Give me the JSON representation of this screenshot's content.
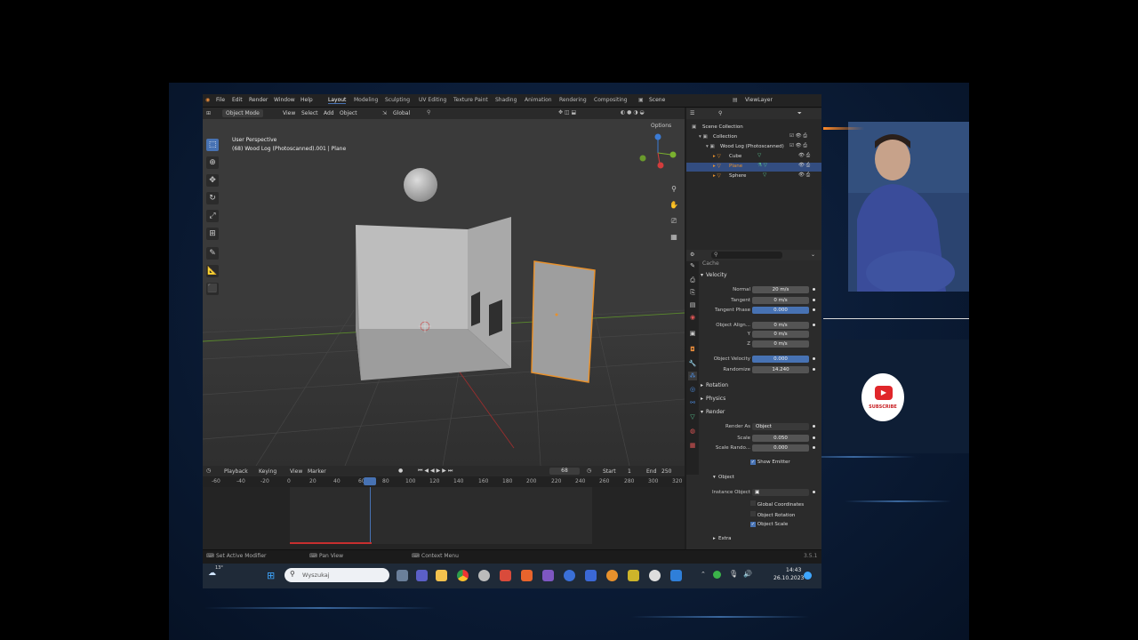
{
  "topbar": {
    "menus": [
      "File",
      "Edit",
      "Render",
      "Window",
      "Help"
    ],
    "workspaces": [
      "Layout",
      "Modeling",
      "Sculpting",
      "UV Editing",
      "Texture Paint",
      "Shading",
      "Animation",
      "Rendering",
      "Compositing"
    ],
    "active_workspace": "Layout",
    "scene": "Scene",
    "viewlayer": "ViewLayer"
  },
  "viewport": {
    "mode": "Object Mode",
    "menus": [
      "View",
      "Select",
      "Add",
      "Object"
    ],
    "orientation": "Global",
    "options": "Options",
    "overlay_title": "User Perspective",
    "overlay_sub": "(68) Wood Log (Photoscanned).001 | Plane"
  },
  "outliner": {
    "title": "Scene Collection",
    "items": [
      {
        "label": "Collection",
        "indent": 1
      },
      {
        "label": "Wood Log (Photoscanned)",
        "indent": 2
      },
      {
        "label": "Cube",
        "indent": 3
      },
      {
        "label": "Plane",
        "indent": 3,
        "selected": true
      },
      {
        "label": "Sphere",
        "indent": 3
      }
    ]
  },
  "properties": {
    "sections": {
      "cache": "Cache",
      "velocity": "Velocity",
      "rotation": "Rotation",
      "physics": "Physics",
      "render": "Render",
      "object": "Object",
      "extra": "Extra"
    },
    "rows": {
      "normal": {
        "label": "Normal",
        "value": "20 m/s"
      },
      "tangent": {
        "label": "Tangent",
        "value": "0 m/s"
      },
      "tangent_phase": {
        "label": "Tangent Phase",
        "value": "0.000"
      },
      "obj_align_x": {
        "label": "Object Align...",
        "value": "0 m/s"
      },
      "obj_align_y": {
        "label": "Y",
        "value": "0 m/s"
      },
      "obj_align_z": {
        "label": "Z",
        "value": "0 m/s"
      },
      "object_velocity": {
        "label": "Object Velocity",
        "value": "0.000"
      },
      "randomize": {
        "label": "Randomize",
        "value": "14.240"
      },
      "render_as": {
        "label": "Render As",
        "value": "Object"
      },
      "scale": {
        "label": "Scale",
        "value": "0.050"
      },
      "scale_random": {
        "label": "Scale Rando...",
        "value": "0.000"
      },
      "instance_object": {
        "label": "Instance Object",
        "value": ""
      }
    },
    "checks": {
      "show_emitter": "Show Emitter",
      "global_coords": "Global Coordinates",
      "object_rotation": "Object Rotation",
      "object_scale": "Object Scale"
    }
  },
  "timeline": {
    "menus": [
      "Playback",
      "Keying",
      "View",
      "Marker"
    ],
    "current_frame": "68",
    "start_label": "Start",
    "start": "1",
    "end_label": "End",
    "end": "250",
    "ticks": [
      "-60",
      "-40",
      "-20",
      "0",
      "20",
      "40",
      "60",
      "80",
      "100",
      "120",
      "140",
      "160",
      "180",
      "200",
      "220",
      "240",
      "260",
      "280",
      "300",
      "320"
    ]
  },
  "statusbar": {
    "left": "Set Active Modifier",
    "mid": "Pan View",
    "right": "Context Menu",
    "version": "3.5.1"
  },
  "taskbar": {
    "weather": "13°",
    "search_placeholder": "Wyszukaj",
    "time": "14:43",
    "date": "26.10.2023"
  },
  "subscribe": {
    "label": "SUBSCRIBE"
  },
  "colors": {
    "accent": "#4772b3",
    "selected_orange": "#e8912c",
    "subscribe_red": "#e0262a"
  }
}
